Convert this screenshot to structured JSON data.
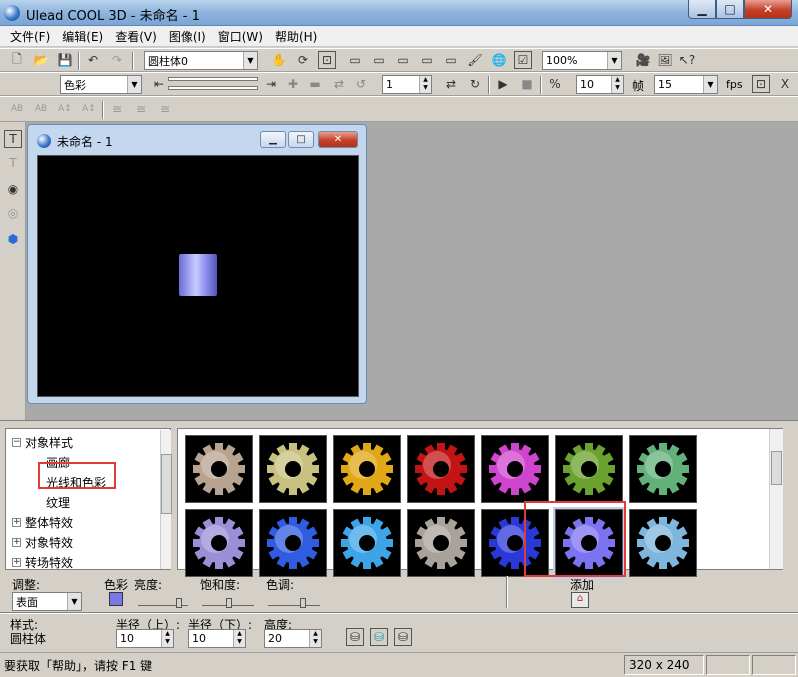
{
  "window": {
    "title": "Ulead COOL 3D - 未命名 - 1"
  },
  "menu": [
    "文件(F)",
    "编辑(E)",
    "查看(V)",
    "图像(I)",
    "窗口(W)",
    "帮助(H)"
  ],
  "toolbar1": {
    "object_select": "圆柱体0",
    "zoom": "100%"
  },
  "toolbar2": {
    "attribute_select": "色彩",
    "frame_value": "1",
    "frames_total": "10",
    "frames_label": "帧",
    "fps_value": "15",
    "fps_label": "fps"
  },
  "child": {
    "title": "未命名 - 1"
  },
  "tree": {
    "items": [
      {
        "label": "对象样式",
        "expander": "−",
        "level": 0
      },
      {
        "label": "画廊",
        "level": 1
      },
      {
        "label": "光线和色彩",
        "level": 1
      },
      {
        "label": "纹理",
        "level": 1
      },
      {
        "label": "整体特效",
        "expander": "+",
        "level": 0
      },
      {
        "label": "对象特效",
        "expander": "+",
        "level": 0
      },
      {
        "label": "转场特效",
        "expander": "+",
        "level": 0
      }
    ]
  },
  "gallery": {
    "colors": [
      "#b7a38f",
      "#c7c07e",
      "#e0a716",
      "#c21414",
      "#d045cf",
      "#6aa12f",
      "#62b07a",
      "#9b8fd8",
      "#2f5ce0",
      "#3ea4e8",
      "#a9a29a",
      "#2b38d8",
      "#7c73f0",
      "#7fb6dd"
    ],
    "selected_index": 12
  },
  "props": {
    "adjust_label": "调整:",
    "adjust_value": "表面",
    "color_label": "色彩",
    "brightness_label": "亮度:",
    "saturation_label": "饱和度:",
    "hue_label": "色调:",
    "add_label": "添加",
    "style_label": "样式:",
    "style_value": "圆柱体",
    "radius_top_label": "半径（上）:",
    "radius_top_value": "10",
    "radius_bottom_label": "半径（下）:",
    "radius_bottom_value": "10",
    "height_label": "高度:",
    "height_value": "20"
  },
  "status": {
    "help": "要获取「帮助」，请按 F1 键",
    "size": "320 x 240"
  }
}
